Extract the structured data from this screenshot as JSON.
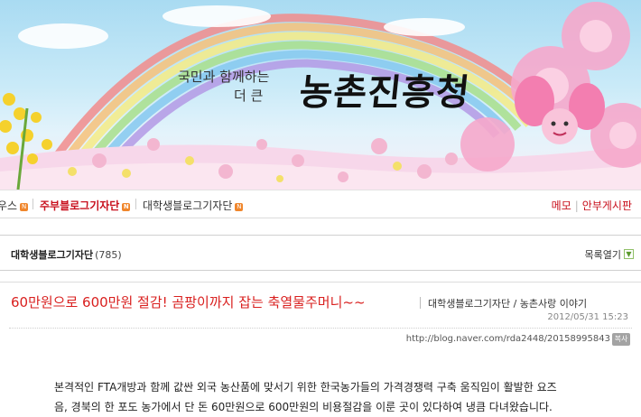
{
  "banner": {
    "tagline_1": "국민과 함께하는",
    "tagline_2": "더 큰",
    "logo": "농촌진흥청"
  },
  "menu": {
    "items": [
      {
        "label": "우스",
        "badge": "N"
      },
      {
        "label": "주부블로그기자단",
        "badge": "N"
      },
      {
        "label": "대학생블로그기자단",
        "badge": "N"
      }
    ],
    "right": {
      "memo": "메모",
      "guestbook": "안부게시판"
    }
  },
  "category": {
    "title": "대학생블로그기자단",
    "count": "(785)",
    "list_toggle": "목록열기"
  },
  "post": {
    "title": "60만원으로 600만원 절감! 곰팡이까지 잡는 축열물주머니~~",
    "category_path": "대학생블로그기자단 / 농촌사랑 이야기",
    "date": "2012/05/31 15:23",
    "url": "http://blog.naver.com/rda2448/20158995843",
    "copy_label": "복사",
    "body_line_1": "본격적인 FTA개방과 함께 값싼 외국 농산품에 맞서기 위한 한국농가들의 가격경쟁력 구축 움직임이 활발한 요즈",
    "body_line_2": "음, 경북의 한 포도 농가에서 단 돈 60만원으로 600만원의 비용절감을 이룬 곳이 있다하여 냉큼 다녀왔습니다."
  },
  "colors": {
    "accent_red": "#d9201f",
    "badge_orange": "#f0862c",
    "sky": "#a9dbf2"
  }
}
